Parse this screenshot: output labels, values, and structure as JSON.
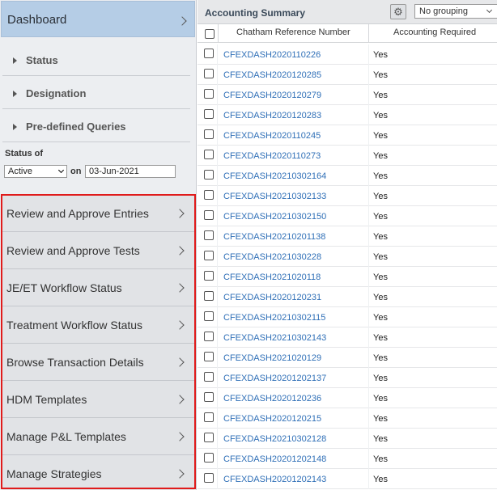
{
  "sidebar": {
    "dashboard_label": "Dashboard",
    "tree": [
      {
        "label": "Status"
      },
      {
        "label": "Designation"
      },
      {
        "label": "Pre-defined Queries"
      }
    ],
    "status_of_label": "Status of",
    "status_value": "Active",
    "on_label": "on",
    "date_value": "03-Jun-2021",
    "nav_items": [
      {
        "label": "Review and Approve Entries"
      },
      {
        "label": "Review and Approve Tests"
      },
      {
        "label": "JE/ET Workflow Status"
      },
      {
        "label": "Treatment Workflow Status"
      },
      {
        "label": "Browse Transaction Details"
      },
      {
        "label": "HDM Templates"
      },
      {
        "label": "Manage P&L Templates"
      },
      {
        "label": "Manage Strategies"
      }
    ],
    "highlight_color": "#e01b1b"
  },
  "grid": {
    "title": "Accounting Summary",
    "grouping_value": "No grouping",
    "columns": [
      "Chatham Reference Number",
      "Accounting Required"
    ],
    "rows": [
      {
        "ref": "CFEXDASH2020110226",
        "acc": "Yes"
      },
      {
        "ref": "CFEXDASH2020120285",
        "acc": "Yes"
      },
      {
        "ref": "CFEXDASH2020120279",
        "acc": "Yes"
      },
      {
        "ref": "CFEXDASH2020120283",
        "acc": "Yes"
      },
      {
        "ref": "CFEXDASH2020110245",
        "acc": "Yes"
      },
      {
        "ref": "CFEXDASH2020110273",
        "acc": "Yes"
      },
      {
        "ref": "CFEXDASH20210302164",
        "acc": "Yes"
      },
      {
        "ref": "CFEXDASH20210302133",
        "acc": "Yes"
      },
      {
        "ref": "CFEXDASH20210302150",
        "acc": "Yes"
      },
      {
        "ref": "CFEXDASH20210201138",
        "acc": "Yes"
      },
      {
        "ref": "CFEXDASH2021030228",
        "acc": "Yes"
      },
      {
        "ref": "CFEXDASH2021020118",
        "acc": "Yes"
      },
      {
        "ref": "CFEXDASH2020120231",
        "acc": "Yes"
      },
      {
        "ref": "CFEXDASH20210302115",
        "acc": "Yes"
      },
      {
        "ref": "CFEXDASH20210302143",
        "acc": "Yes"
      },
      {
        "ref": "CFEXDASH2021020129",
        "acc": "Yes"
      },
      {
        "ref": "CFEXDASH20201202137",
        "acc": "Yes"
      },
      {
        "ref": "CFEXDASH2020120236",
        "acc": "Yes"
      },
      {
        "ref": "CFEXDASH2020120215",
        "acc": "Yes"
      },
      {
        "ref": "CFEXDASH20210302128",
        "acc": "Yes"
      },
      {
        "ref": "CFEXDASH20201202148",
        "acc": "Yes"
      },
      {
        "ref": "CFEXDASH20201202143",
        "acc": "Yes"
      }
    ],
    "link_color": "#2f6fb7"
  },
  "icons": {
    "chevron": "chevron-right-icon",
    "expand": "triangle-right-icon",
    "settings": "gear-icon",
    "dropdown": "chevron-down-icon"
  }
}
